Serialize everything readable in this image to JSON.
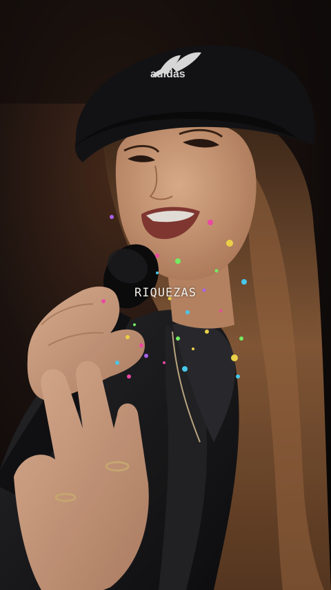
{
  "caption": {
    "text": "RIQUEZAS"
  },
  "cap_logo": {
    "text": "adidas"
  },
  "photo": {
    "background_color": "#1b1210",
    "hair_color": "#7a5234",
    "skin_color": "#d9a37f",
    "cap_color": "#141416",
    "jacket_color": "#1c1c1e",
    "sparkle_colors": [
      "#ff4fb0",
      "#4fd8ff",
      "#ffe14f",
      "#7dff6b",
      "#b86bff"
    ]
  }
}
